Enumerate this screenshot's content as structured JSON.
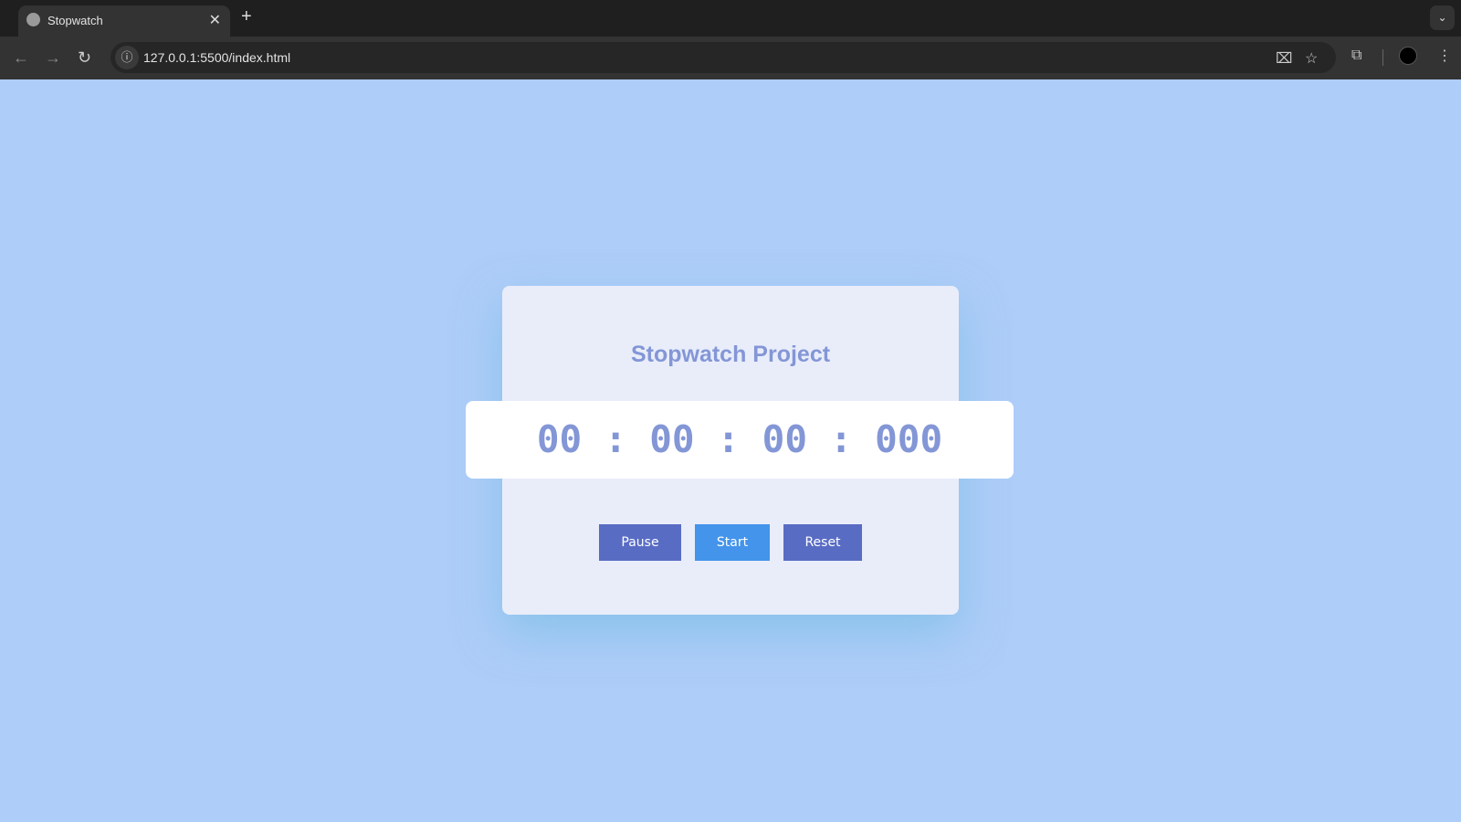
{
  "browser": {
    "tab_title": "Stopwatch",
    "url": "127.0.0.1:5500/index.html"
  },
  "page": {
    "heading": "Stopwatch Project",
    "time_display": "00 : 00 : 00 : 000",
    "buttons": {
      "pause": "Pause",
      "start": "Start",
      "reset": "Reset"
    }
  },
  "colors": {
    "background": "#aecdf8",
    "card": "#e9edfa",
    "accent": "#8396d6",
    "pause_reset": "#586cc4",
    "start": "#4394ea"
  }
}
